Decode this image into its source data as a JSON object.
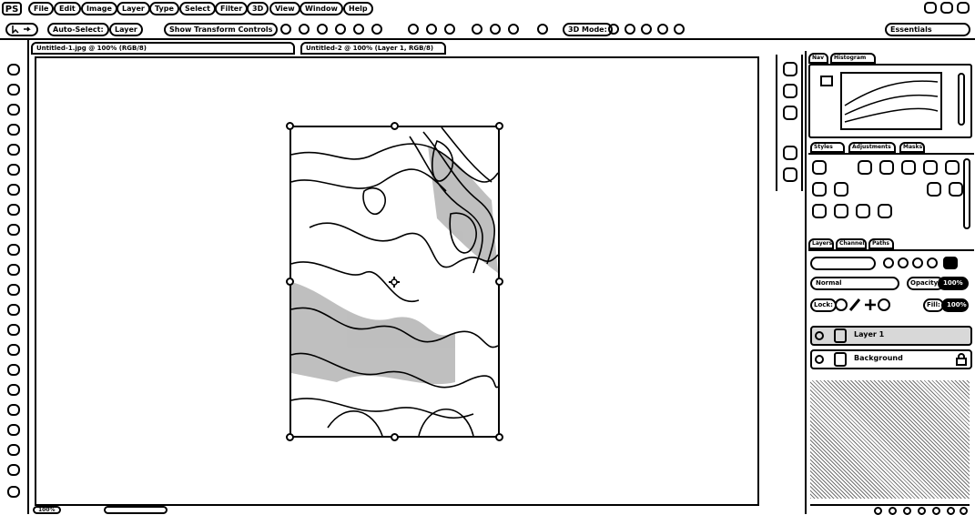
{
  "app": {
    "logo": "PS"
  },
  "menu": [
    "File",
    "Edit",
    "Image",
    "Layer",
    "Type",
    "Select",
    "Filter",
    "3D",
    "View",
    "Window",
    "Help"
  ],
  "options": {
    "auto_select": "Auto-Select:",
    "layer_dropdown": "Layer",
    "transform_controls": "Show Transform Controls",
    "mode_3d": "3D Mode:",
    "workspace": "Essentials"
  },
  "doc_tabs": [
    {
      "label": "Untitled-1.jpg @ 100% (RGB/8)"
    },
    {
      "label": "Untitled-2 @ 100% (Layer 1, RGB/8)"
    }
  ],
  "panels": {
    "navigator_tabs": [
      "Nav",
      "Histogram"
    ],
    "swatch_tabs": [
      "Styles",
      "Adjustments",
      "Masks"
    ],
    "layer_tabs": [
      "Layers",
      "Channels",
      "Paths"
    ],
    "blend_mode": "Normal",
    "opacity_label": "Opacity:",
    "opacity_value": "100%",
    "fill_label": "Fill:",
    "fill_value": "100%",
    "lock_label": "Lock:"
  },
  "layers": [
    {
      "name": "Layer 1",
      "selected": true
    },
    {
      "name": "Background",
      "selected": false
    }
  ],
  "status": {
    "zoom": "100%"
  }
}
